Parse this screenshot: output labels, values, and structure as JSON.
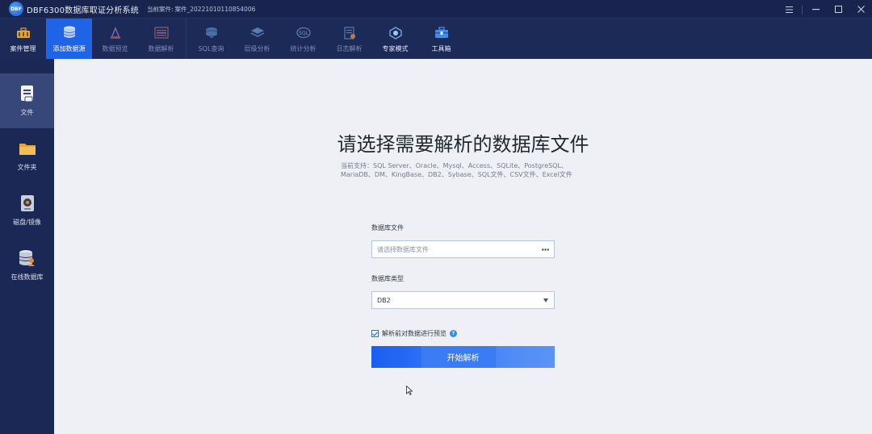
{
  "titlebar": {
    "logo_text": "DBF",
    "app_title": "DBF6300数据库取证分析系统",
    "case_label": "当前案件:",
    "case_value": "案件_20221010110854006"
  },
  "toolbar": {
    "items": [
      {
        "label": "案件管理",
        "icon": "briefcase-icon"
      },
      {
        "label": "添加数据源",
        "icon": "database-add-icon"
      },
      {
        "label": "数据预览",
        "icon": "preview-icon"
      },
      {
        "label": "数据解析",
        "icon": "parse-icon"
      },
      {
        "label": "SQL查询",
        "icon": "sql-query-icon"
      },
      {
        "label": "层级分析",
        "icon": "layer-icon"
      },
      {
        "label": "统计分析",
        "icon": "statistics-icon"
      },
      {
        "label": "日志解析",
        "icon": "log-icon"
      },
      {
        "label": "专家模式",
        "icon": "expert-icon"
      },
      {
        "label": "工具箱",
        "icon": "toolbox-icon"
      }
    ]
  },
  "sidebar": {
    "items": [
      {
        "label": "文件",
        "icon": "file-icon"
      },
      {
        "label": "文件夹",
        "icon": "folder-icon"
      },
      {
        "label": "磁盘/镜像",
        "icon": "disk-icon"
      },
      {
        "label": "在线数据库",
        "icon": "online-database-icon"
      }
    ]
  },
  "main": {
    "headline": "请选择需要解析的数据库文件",
    "support_text": "当前支持：SQL Server、Oracle、Mysql、Access、SQLite、PostgreSQL、MariaDB、DM、KingBase、DB2、Sybase、SQL文件、CSV文件、Excel文件",
    "db_file_label": "数据库文件",
    "db_file_placeholder": "请选择数据库文件",
    "browse_label": "···",
    "db_type_label": "数据库类型",
    "db_type_value": "DB2",
    "preview_checkbox_label": "解析前对数据进行预览",
    "help_glyph": "?",
    "start_button": "开始解析"
  },
  "colors": {
    "accent": "#1f63e9",
    "titlebar_bg": "#18244d",
    "sidebar_bg": "#1b2754",
    "main_bg": "#eef0f6"
  }
}
